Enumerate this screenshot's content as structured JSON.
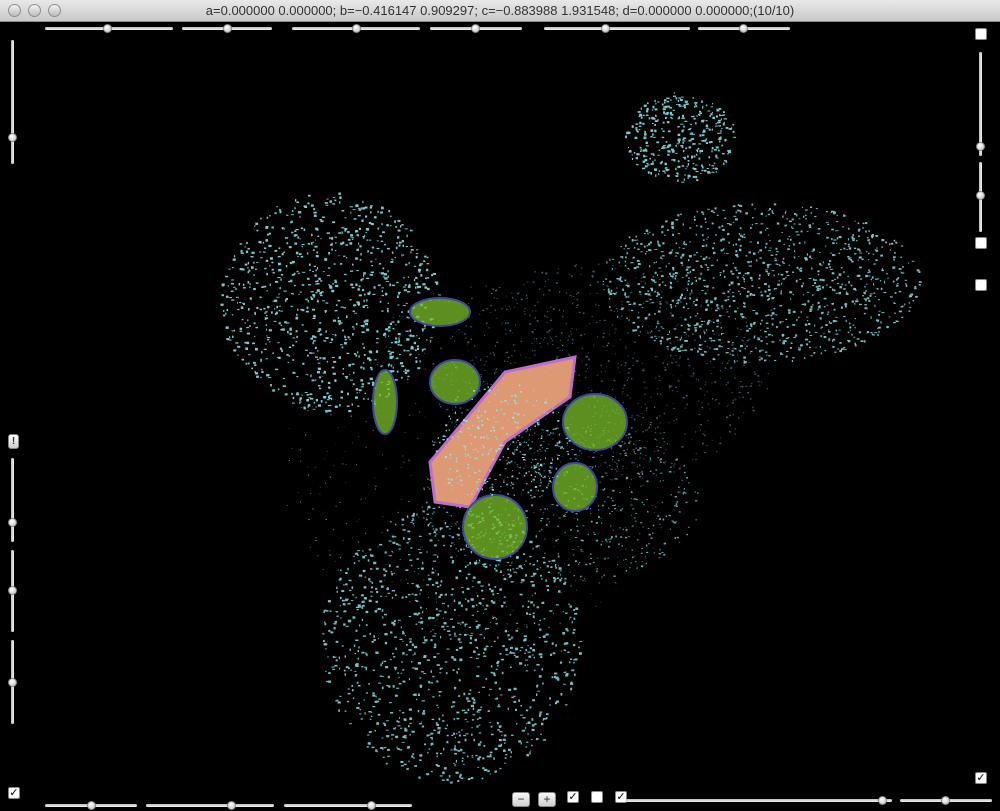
{
  "window": {
    "title": "a=0.000000 0.000000; b=−0.416147 0.909297; c=−0.883988 1.931548; d=0.000000 0.000000;(10/10)"
  },
  "controls": {
    "minus_label": "−",
    "plus_label": "+",
    "check_mark": "✓",
    "warning_label": "!"
  },
  "viewport": {
    "background": "#000000",
    "cloud_color": "#8ef0f5",
    "body_color": "#e8a27a",
    "leaf_color": "#7bbf2a",
    "outline_color": "#3a4a9e",
    "accent_color": "#c873d6"
  }
}
